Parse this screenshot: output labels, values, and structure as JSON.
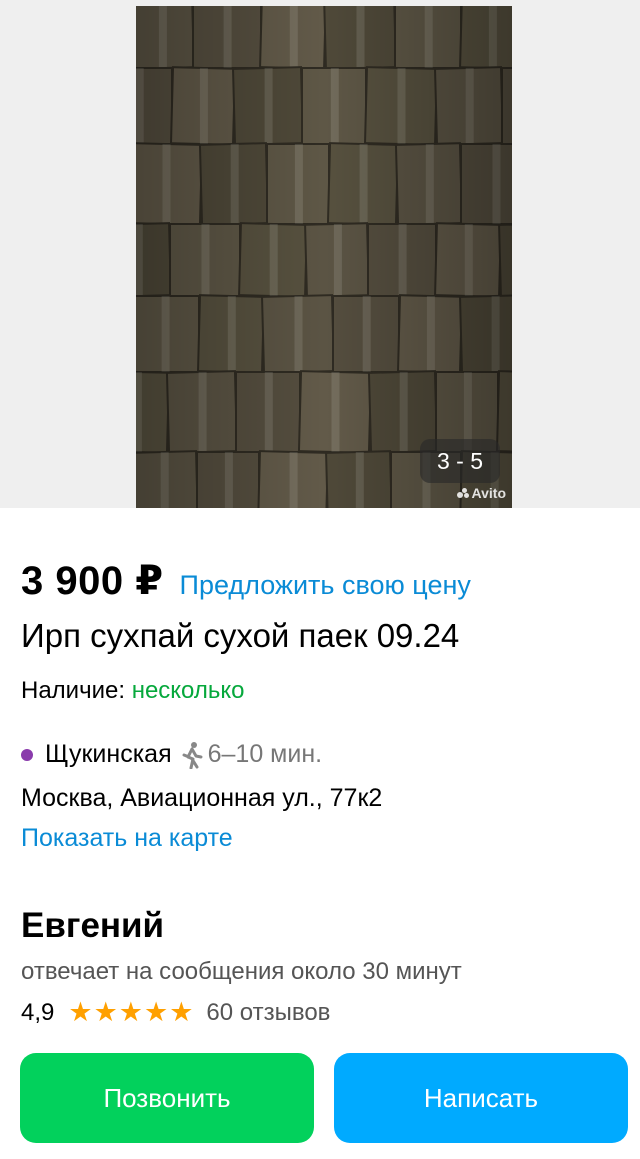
{
  "gallery": {
    "counter": "3 - 5",
    "watermark": "Avito"
  },
  "listing": {
    "price": "3 900 ₽",
    "offer_link": "Предложить свою цену",
    "title": "Ирп сухпай сухой паек 09.24",
    "availability_label": "Наличие:",
    "availability_value": "несколько"
  },
  "location": {
    "metro_station": "Щукинская",
    "metro_color": "#8a3bac",
    "walk_time": "6–10 мин.",
    "address": "Москва, Авиационная ул., 77к2",
    "map_link": "Показать на карте"
  },
  "seller": {
    "name": "Евгений",
    "reply_time": "отвечает на сообщения около 30 минут",
    "rating": "4,9",
    "stars": "★★★★★",
    "reviews": "60 отзывов"
  },
  "actions": {
    "call_label": "Позвонить",
    "write_label": "Написать",
    "call_color": "#02d15c",
    "write_color": "#00aaff"
  }
}
